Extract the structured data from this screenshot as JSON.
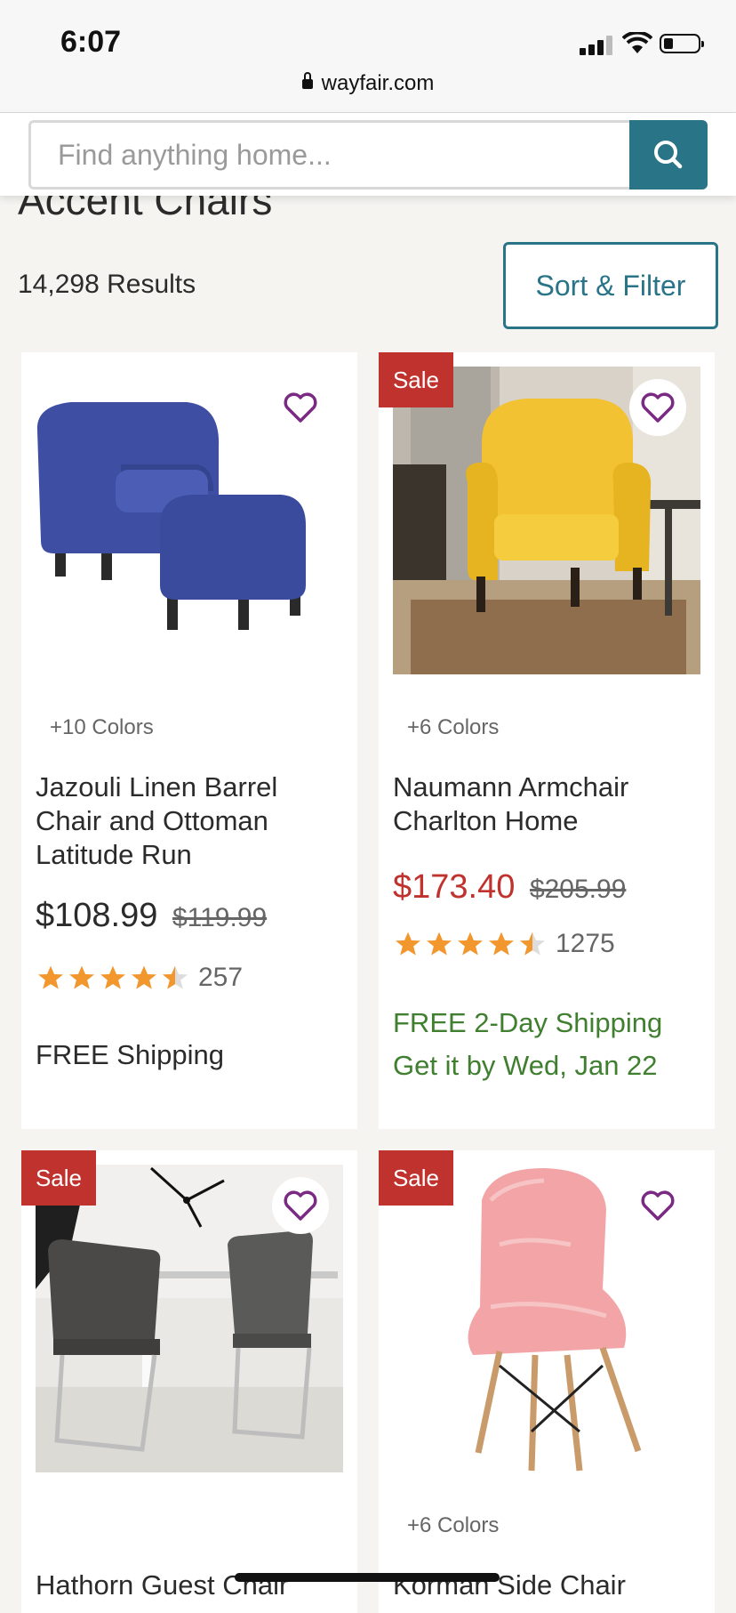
{
  "status": {
    "time": "6:07",
    "url": "wayfair.com"
  },
  "search": {
    "placeholder": "Find anything home..."
  },
  "page": {
    "title": "Accent Chairs",
    "results": "14,298 Results",
    "sort_filter": "Sort & Filter"
  },
  "colors": {
    "accent": "#2a7487",
    "sale": "#c0322e",
    "heart": "#7b2a83",
    "star": "#f2962e",
    "ship_green": "#3f7f2f"
  },
  "products": [
    {
      "sale": false,
      "colors": "+10 Colors",
      "title": "Jazouli Linen Barrel Chair and Ottoman Latitude Run",
      "price": "$108.99",
      "was": "$119.99",
      "rating": 4.5,
      "reviews": "257",
      "ship1": "FREE Shipping",
      "ship2": ""
    },
    {
      "sale": true,
      "sale_label": "Sale",
      "colors": "+6 Colors",
      "title": "Naumann Armchair Charlton Home",
      "price": "$173.40",
      "was": "$205.99",
      "rating": 4.5,
      "reviews": "1275",
      "ship1": "FREE 2-Day Shipping",
      "ship2": "Get it by Wed, Jan 22"
    },
    {
      "sale": true,
      "sale_label": "Sale",
      "colors": "",
      "title": "Hathorn Guest Chair"
    },
    {
      "sale": true,
      "sale_label": "Sale",
      "colors": "+6 Colors",
      "title": "Korman Side Chair"
    }
  ]
}
